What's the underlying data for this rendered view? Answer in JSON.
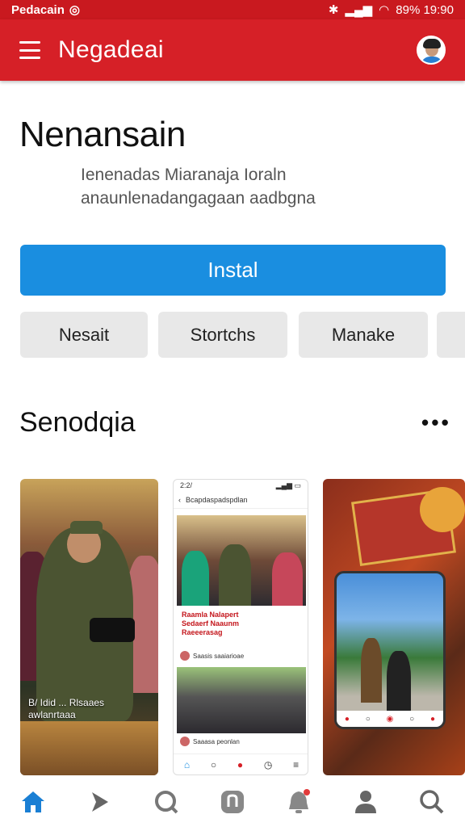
{
  "status_bar": {
    "left_text": "Pedacain",
    "right_text": "89% 19:90"
  },
  "app_bar": {
    "title": "Negadeai"
  },
  "app": {
    "name": "Nenansain",
    "description": "Ienenadas Miaranaja Ioraln anaunlenadangagaan aadbgna"
  },
  "install_label": "Instal",
  "chips": [
    "Nesait",
    "Stortchs",
    "Manake"
  ],
  "section": {
    "title": "Senodqia"
  },
  "screenshot1": {
    "caption": "B/ Idid ... Rlsaaes\nawlanrtaaa"
  },
  "screenshot2": {
    "time": "2:2/",
    "bar_title": "Bcapdaspadspdlan",
    "headline": "Raamla Nalapert\nSedaerf Naaunm\nRaeeerasag",
    "row1": "Saasis saaiarioae",
    "row2": "Saaasa peonlan"
  },
  "bottom_nav": [
    {
      "name": "nav-home",
      "icon": "home-icon"
    },
    {
      "name": "nav-play",
      "icon": "play-icon"
    },
    {
      "name": "nav-search",
      "icon": "search-icon"
    },
    {
      "name": "nav-apps",
      "icon": "app-icon"
    },
    {
      "name": "nav-notifications",
      "icon": "bell-icon"
    },
    {
      "name": "nav-account",
      "icon": "person-icon"
    },
    {
      "name": "nav-find",
      "icon": "magnifier-icon"
    }
  ],
  "colors": {
    "brand_red": "#d62027",
    "install_blue": "#1a8ee0",
    "chip_gray": "#e8e8e8"
  }
}
